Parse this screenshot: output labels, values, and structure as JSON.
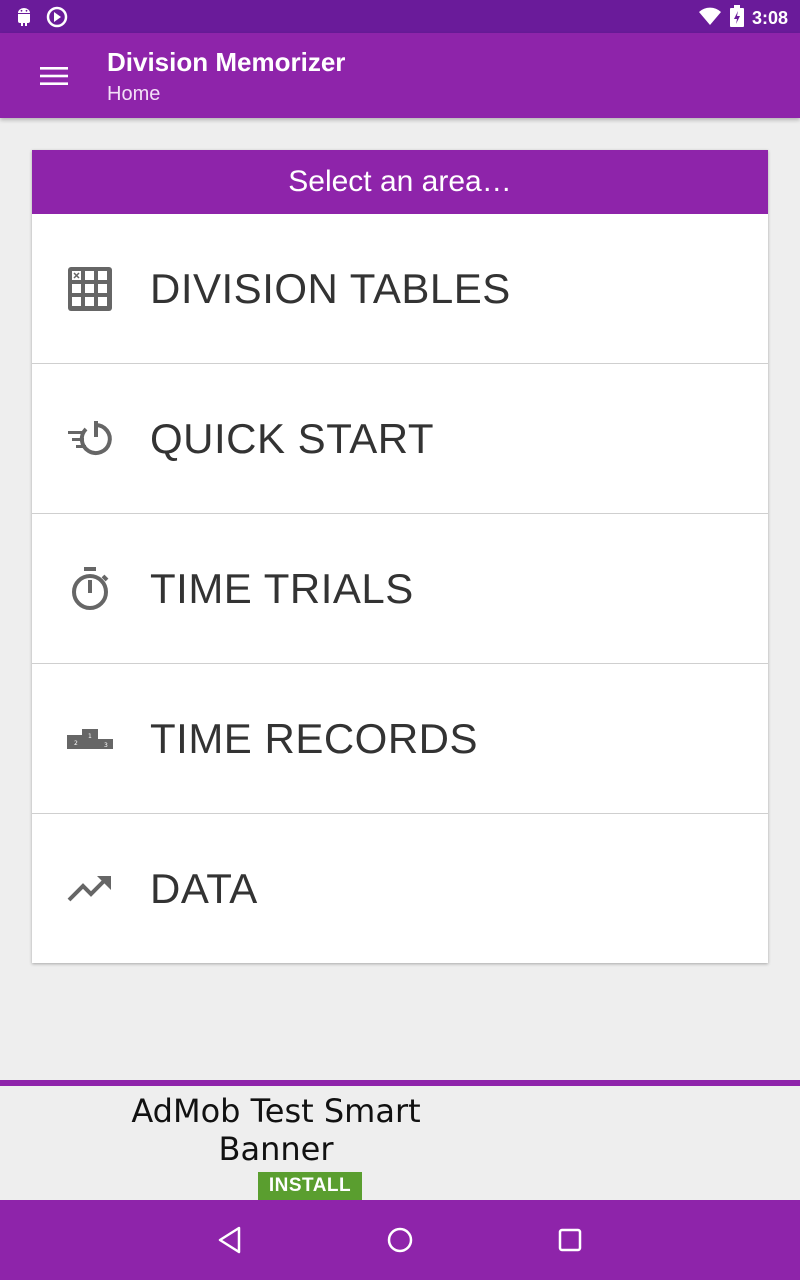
{
  "status_bar": {
    "time": "3:08",
    "icons": [
      "android-icon",
      "sync-icon",
      "wifi-icon",
      "battery-icon"
    ]
  },
  "app_bar": {
    "title": "Division Memorizer",
    "subtitle": "Home",
    "menu_icon": "hamburger-menu-icon"
  },
  "card": {
    "header": "Select an area…",
    "items": [
      {
        "label": "DIVISION TABLES",
        "icon": "table-grid-icon"
      },
      {
        "label": "QUICK START",
        "icon": "quick-timer-icon"
      },
      {
        "label": "TIME TRIALS",
        "icon": "stopwatch-icon"
      },
      {
        "label": "TIME RECORDS",
        "icon": "podium-icon"
      },
      {
        "label": "DATA",
        "icon": "trending-up-icon"
      }
    ]
  },
  "ad": {
    "text": "AdMob Test Smart Banner",
    "install_label": "INSTALL"
  },
  "nav_bar": {
    "icons": [
      "back-icon",
      "home-icon",
      "recents-icon"
    ]
  },
  "colors": {
    "primary": "#8e24aa",
    "primary_dark": "#6a1b9a",
    "background": "#eeeeee",
    "install_green": "#5a9e2f"
  }
}
